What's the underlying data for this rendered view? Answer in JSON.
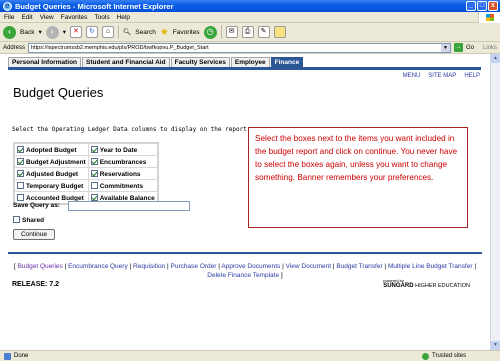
{
  "window": {
    "title": "Budget Queries - Microsoft Internet Explorer",
    "minimize": "_",
    "maximize": "□",
    "close": "x"
  },
  "menu": [
    "File",
    "Edit",
    "View",
    "Favorites",
    "Tools",
    "Help"
  ],
  "toolbar": {
    "back_label": "Back",
    "search_label": "Search",
    "favorites_label": "Favorites"
  },
  "address": {
    "label": "Address",
    "url": "https://ispectrumssb2.memphis.edu/pls/PROD/bwfkopvu.P_Budget_Start",
    "go_label": "Go",
    "links_label": "Links"
  },
  "tabs": [
    {
      "label": "Personal Information",
      "active": false
    },
    {
      "label": "Student and Financial Aid",
      "active": false
    },
    {
      "label": "Faculty Services",
      "active": false
    },
    {
      "label": "Employee",
      "active": false
    },
    {
      "label": "Finance",
      "active": true
    }
  ],
  "toplinks": [
    "MENU",
    "SITE MAP",
    "HELP"
  ],
  "page": {
    "title": "Budget Queries",
    "instruction": "Select the Operating Ledger Data columns to display on the report.",
    "columns": [
      [
        {
          "label": "Adopted Budget",
          "checked": true
        },
        {
          "label": "Budget Adjustment",
          "checked": true
        },
        {
          "label": "Adjusted Budget",
          "checked": true
        },
        {
          "label": "Temporary Budget",
          "checked": false
        },
        {
          "label": "Accounted Budget",
          "checked": false
        }
      ],
      [
        {
          "label": "Year to Date",
          "checked": true
        },
        {
          "label": "Encumbrances",
          "checked": true
        },
        {
          "label": "Reservations",
          "checked": true
        },
        {
          "label": "Commitments",
          "checked": false
        },
        {
          "label": "Available Balance",
          "checked": true
        }
      ]
    ],
    "save_query_label": "Save Query as:",
    "save_query_value": "",
    "shared_label": "Shared",
    "continue_label": "Continue"
  },
  "callout": {
    "text": "Select the boxes next to the items you want included in the budget report and click on continue. You never have to select the boxes again, unless you want to change something. Banner remembers your preferences."
  },
  "footer": {
    "links": [
      "Budget Queries",
      "Encumbrance Query",
      "Requisition",
      "Purchase Order",
      "Approve Documents",
      "View Document",
      "Budget Transfer",
      "Multiple Line Budget Transfer",
      "Delete Finance Template"
    ],
    "open_bracket": "[",
    "close_bracket": "]",
    "separator": "|",
    "release": "RELEASE: 7.2",
    "powered_by": "powered by",
    "brand_name": "SUNGARD",
    "brand_suffix": " HIGHER EDUCATION"
  },
  "status": {
    "left": "Done",
    "right": "Trusted sites"
  },
  "colors": {
    "accent": "#2b5797",
    "callout_text": "#cc0000",
    "link": "#2a3aa5"
  }
}
